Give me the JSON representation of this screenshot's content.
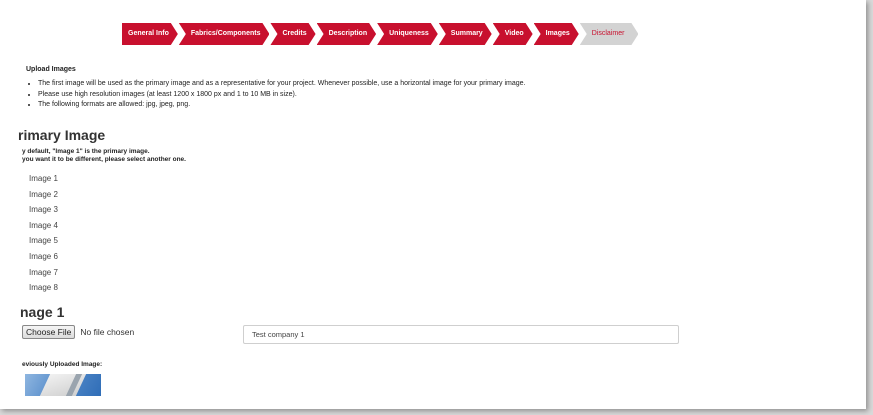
{
  "steps": [
    {
      "label": "General Info"
    },
    {
      "label": "Fabrics/Components"
    },
    {
      "label": "Credits"
    },
    {
      "label": "Description"
    },
    {
      "label": "Uniqueness"
    },
    {
      "label": "Summary"
    },
    {
      "label": "Video"
    },
    {
      "label": "Images"
    },
    {
      "label": "Disclaimer"
    }
  ],
  "upload": {
    "title": "Upload Images",
    "bullets": [
      "The first image will be used as the primary image and as a representative for your project. Whenever possible, use a horizontal image for your primary image.",
      "Please use high resolution images (at least 1200 x 1800 px and 1 to 10 MB in size).",
      "The following formats are allowed: jpg, jpeg, png."
    ]
  },
  "primary": {
    "heading": "rimary Image",
    "note_line1": "y default, \"Image 1\" is the primary image.",
    "note_line2": "you want it to be different, please select another one.",
    "options": [
      "Image 1",
      "Image 2",
      "Image 3",
      "Image 4",
      "Image 5",
      "Image 6",
      "Image 7",
      "Image 8"
    ]
  },
  "image1": {
    "heading": "nage 1",
    "choose_label": "Choose File",
    "file_status": "No file chosen",
    "caption_value": "Test company 1",
    "previous_label": "eviously Uploaded Image:"
  },
  "colors": {
    "accent": "#c8102e",
    "inactive_step": "#d3d3d3"
  }
}
